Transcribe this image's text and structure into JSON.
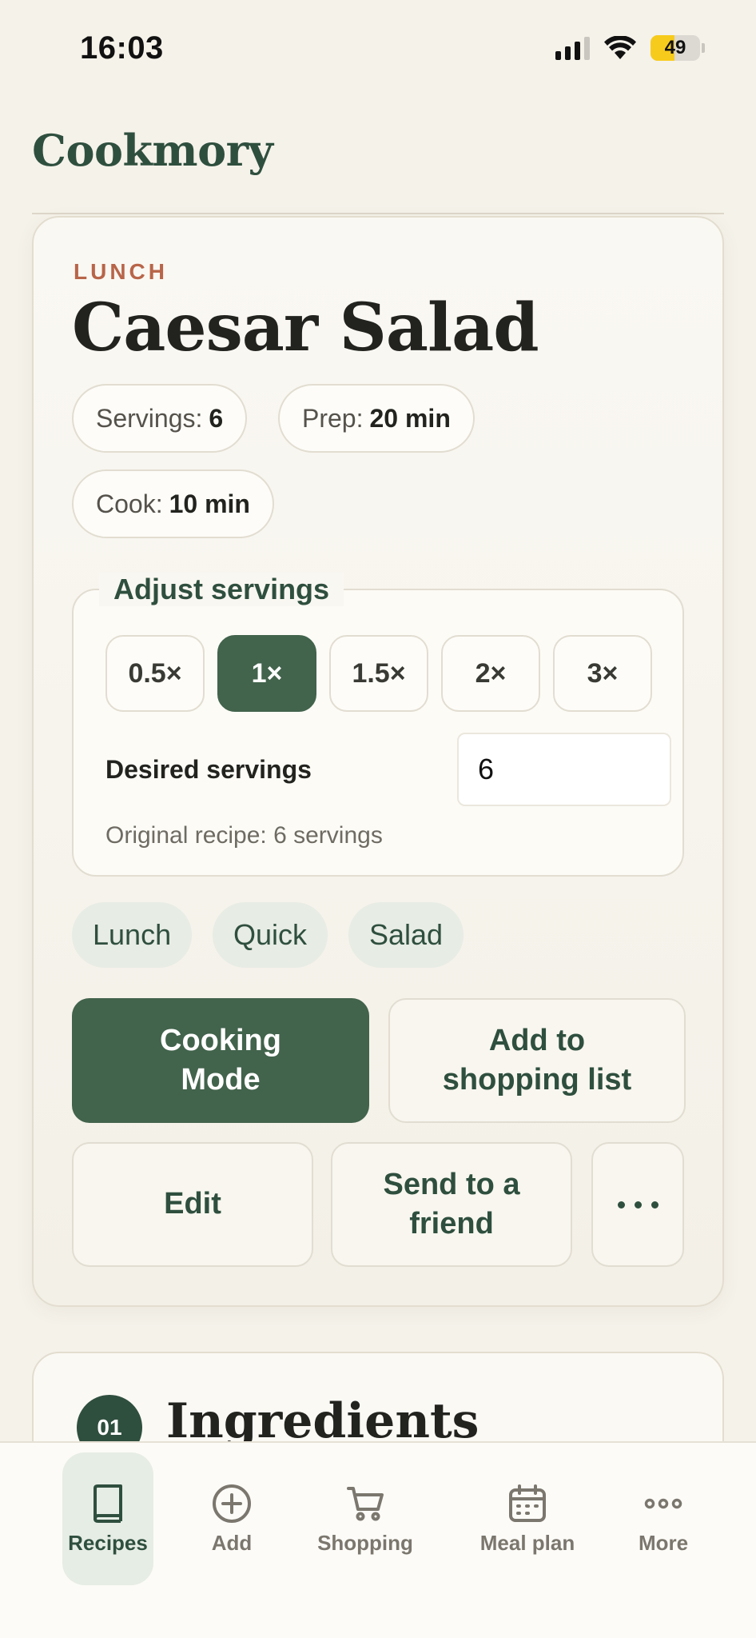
{
  "status_bar": {
    "time": "16:03",
    "battery": "49"
  },
  "app": {
    "title": "Cookmory"
  },
  "recipe": {
    "category": "LUNCH",
    "title": "Caesar Salad",
    "meta": {
      "servings_label": "Servings:",
      "servings_value": "6",
      "prep_label": "Prep:",
      "prep_value": "20 min",
      "cook_label": "Cook:",
      "cook_value": "10 min"
    },
    "adjust": {
      "legend": "Adjust servings",
      "multipliers": [
        "0.5×",
        "1×",
        "1.5×",
        "2×",
        "3×"
      ],
      "selected": "1×",
      "desired_label": "Desired servings",
      "desired_value": "6",
      "original_note": "Original recipe: 6 servings"
    },
    "tags": [
      "Lunch",
      "Quick",
      "Salad"
    ],
    "actions": {
      "cooking_mode": "Cooking Mode",
      "add_to_list": "Add to shopping list",
      "edit": "Edit",
      "send": "Send to a friend"
    }
  },
  "ingredients": {
    "number": "01",
    "title": "Ingredients"
  },
  "tabs": [
    {
      "label": "Recipes",
      "icon": "book-icon",
      "active": true
    },
    {
      "label": "Add",
      "icon": "plus-circle-icon",
      "active": false
    },
    {
      "label": "Shopping",
      "icon": "cart-icon",
      "active": false
    },
    {
      "label": "Meal plan",
      "icon": "calendar-icon",
      "active": false
    },
    {
      "label": "More",
      "icon": "more-icon",
      "active": false
    }
  ],
  "colors": {
    "accent": "#42634c",
    "category": "#b86549",
    "background": "#f5f2ea"
  }
}
